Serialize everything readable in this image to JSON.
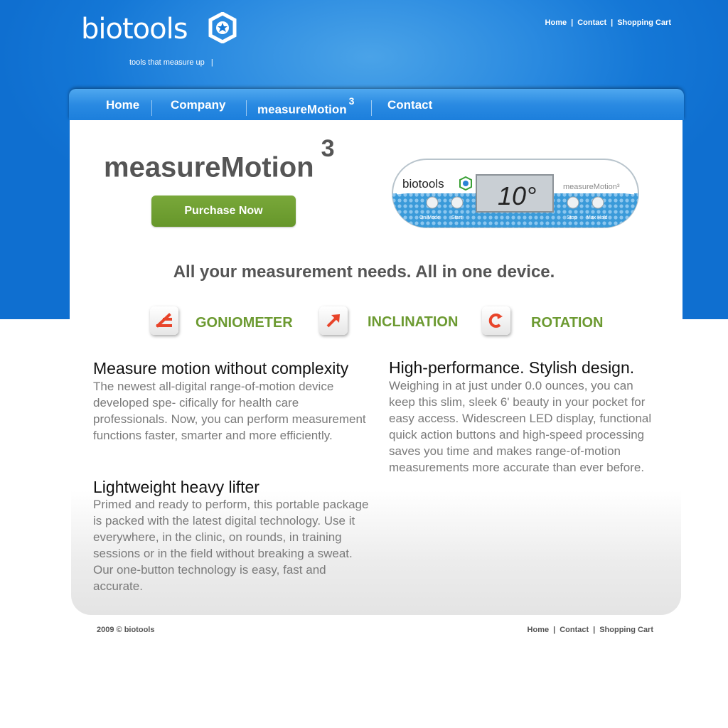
{
  "brand": {
    "name": "biotools",
    "tagline": "tools that measure up",
    "tagline_sep": "|"
  },
  "top_links": {
    "home": "Home",
    "contact": "Contact",
    "cart": "Shopping Cart",
    "sep": "|"
  },
  "nav": {
    "home": "Home",
    "company": "Company",
    "product": "measureMotion",
    "product_sup": "3",
    "contact": "Contact"
  },
  "hero": {
    "title": "measureMotion",
    "title_sup": "3",
    "purchase_label": "Purchase Now"
  },
  "device": {
    "brand": "biotools",
    "display": "10°",
    "model": "measureMotion³",
    "buttons": [
      "On/Mode",
      "Start",
      "Stop",
      "Max Hold"
    ]
  },
  "headline": "All your measurement needs. All in one device.",
  "features": [
    {
      "label": "GONIOMETER",
      "icon": "goniometer-icon"
    },
    {
      "label": "INCLINATION",
      "icon": "inclination-icon"
    },
    {
      "label": "ROTATION",
      "icon": "rotation-icon"
    }
  ],
  "sections": {
    "s1_title": "Measure motion without complexity",
    "s1_body": "The newest all-digital range-of-motion device developed spe- cifically for health care professionals. Now, you can perform measurement functions faster, smarter and more efficiently.",
    "s2_title": "Lightweight heavy lifter",
    "s2_body": "Primed and ready to perform, this portable package is packed with the latest digital technology. Use it everywhere, in the clinic, on rounds, in training sessions or in the field without breaking a sweat. Our one-button technology is easy, fast and accurate.",
    "s3_title": "High-performance. Stylish design.",
    "s3_body": "Weighing in at just under 0.0 ounces, you can keep this slim, sleek 6' beauty in your pocket for easy access. Widescreen LED display, functional quick action buttons and high-speed processing saves you time and makes range-of-motion measurements more accurate than ever before."
  },
  "footer": {
    "copyright": "2009 © biotools",
    "home": "Home",
    "contact": "Contact",
    "cart": "Shopping Cart",
    "sep": "|"
  },
  "colors": {
    "brand_blue": "#1477d6",
    "accent_green": "#6c9a31",
    "icon_red": "#e8442a"
  }
}
